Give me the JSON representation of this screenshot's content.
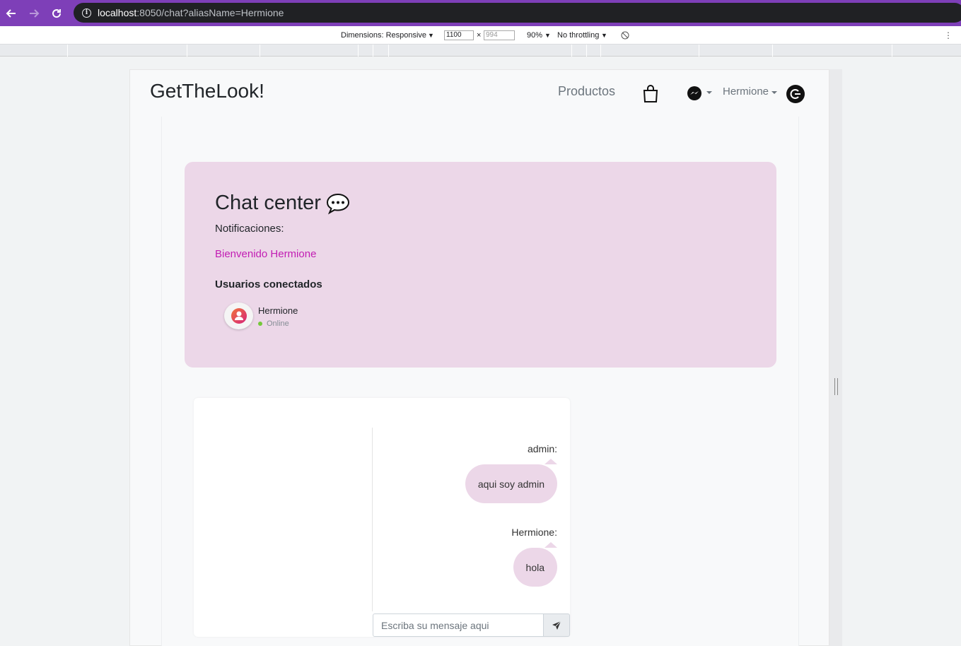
{
  "browser": {
    "url_host": "localhost",
    "url_rest": ":8050/chat?aliasName=Hermione"
  },
  "devtools": {
    "dimensions_label": "Dimensions: Responsive",
    "width_value": "1100",
    "times": "×",
    "height_placeholder": "994",
    "zoom": "90%",
    "throttling": "No throttling"
  },
  "navbar": {
    "brand": "GetTheLook!",
    "products_link": "Productos",
    "user_menu": "Hermione"
  },
  "chat_center": {
    "title": "Chat center",
    "notifications_label": "Notificaciones:",
    "welcome_message": "Bienvenido Hermione",
    "connected_users_heading": "Usuarios conectados",
    "users": [
      {
        "name": "Hermione",
        "status": "Online"
      }
    ]
  },
  "chat": {
    "messages": [
      {
        "sender": "admin:",
        "text": "aqui soy admin"
      },
      {
        "sender": "Hermione:",
        "text": "hola"
      }
    ],
    "input_placeholder": "Escriba su mensaje aqui"
  },
  "colors": {
    "accent_pink": "#ecd7e8",
    "welcome_text": "#c21db3",
    "online": "#74c83a",
    "browser_chrome": "#7e3fb8"
  }
}
